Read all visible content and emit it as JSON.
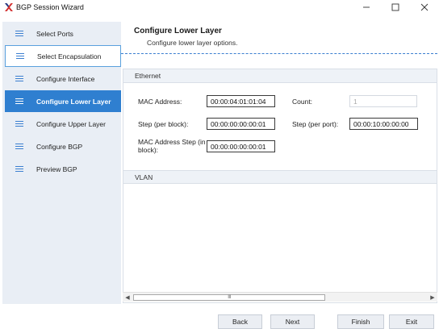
{
  "window": {
    "title": "BGP Session Wizard",
    "controls": {
      "minimize": "—",
      "maximize": "☐",
      "close": "✕"
    }
  },
  "sidebar": {
    "items": [
      {
        "label": "Select Ports",
        "state": "normal"
      },
      {
        "label": "Select Encapsulation",
        "state": "outlined"
      },
      {
        "label": "Configure Interface",
        "state": "normal"
      },
      {
        "label": "Configure Lower Layer",
        "state": "active"
      },
      {
        "label": "Configure Upper Layer",
        "state": "normal"
      },
      {
        "label": "Configure BGP",
        "state": "normal"
      },
      {
        "label": "Preview BGP",
        "state": "normal"
      }
    ]
  },
  "header": {
    "title": "Configure Lower Layer",
    "subtitle": "Configure lower layer options."
  },
  "ethernet": {
    "group_label": "Ethernet",
    "mac_address_label": "MAC Address:",
    "mac_address_value": "00:00:04:01:01:04",
    "count_label": "Count:",
    "count_value": "1",
    "step_block_label": "Step (per block):",
    "step_block_value": "00:00:00:00:00:01",
    "step_port_label": "Step (per port):",
    "step_port_value": "00:00:10:00:00:00",
    "mac_step_block_label": "MAC Address Step (in block):",
    "mac_step_block_value": "00:00:00:00:00:01"
  },
  "vlan": {
    "group_label": "VLAN"
  },
  "scrollbar": {
    "grip": "III",
    "left_arrow": "◀",
    "right_arrow": "▶"
  },
  "buttons": {
    "back": "Back",
    "next": "Next",
    "finish": "Finish",
    "exit": "Exit"
  },
  "colors": {
    "accent": "#2f7fd0",
    "sidebar_bg": "#e9eef5",
    "logo_red": "#d22d2d"
  }
}
